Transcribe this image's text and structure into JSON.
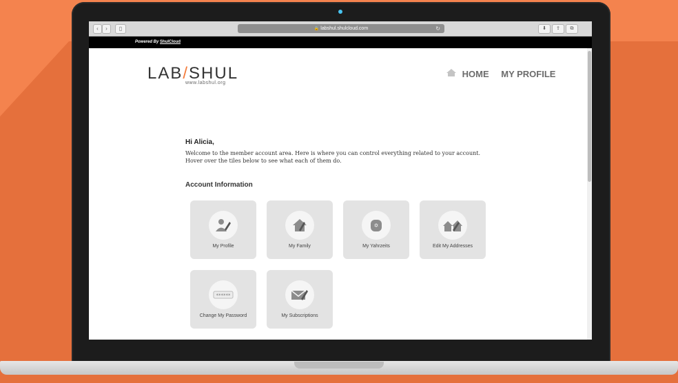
{
  "browser": {
    "url": "labshul.shulcloud.com",
    "lock_icon": "🔒",
    "reload_icon": "↻",
    "back_icon": "‹",
    "forward_icon": "›",
    "sidebar_icon": "▯",
    "download_icon": "⬇",
    "share_icon": "⇪",
    "tabs_icon": "⧉"
  },
  "powered_bar": {
    "prefix": "Powered By",
    "link": "ShulCloud"
  },
  "site": {
    "logo_left": "LAB",
    "logo_slash": "/",
    "logo_right": "SHUL",
    "logo_url": "www.labshul.org",
    "nav": [
      "HOME",
      "MY PROFILE"
    ]
  },
  "content": {
    "greeting": "Hi Alicia,",
    "intro": "Welcome to the member account area. Here is where you can control everything related to your account. Hover over the tiles below to see what each of them do.",
    "section_title": "Account Information"
  },
  "tiles": [
    {
      "label": "My Profile",
      "icon": "✎"
    },
    {
      "label": "My Family",
      "icon": "✎"
    },
    {
      "label": "My Yahrzeits",
      "icon": "✡"
    },
    {
      "label": "Edit My Addresses",
      "icon": "✎"
    },
    {
      "label": "Change My Password",
      "icon": "••••••"
    },
    {
      "label": "My Subscriptions",
      "icon": "✉"
    }
  ],
  "colors": {
    "background": "#f4834e",
    "accent": "#f47c3c"
  }
}
